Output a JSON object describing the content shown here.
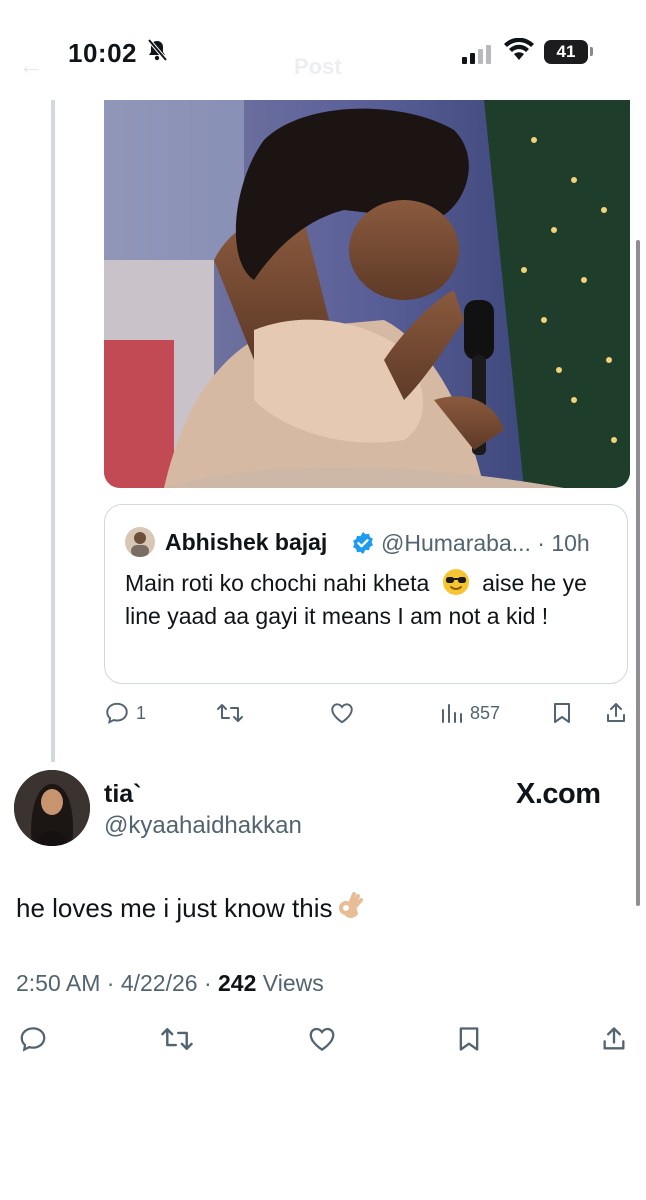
{
  "status_bar": {
    "time": "10:02",
    "battery": "41"
  },
  "header": {
    "title": "Post"
  },
  "quoted": {
    "author_name": "Abhishek bajaj",
    "handle_time": "@Humaraba... · 10h",
    "text_1": "Main roti ko chochi nahi kheta",
    "text_2": "aise he ye line yaad aa gayi it means I am not a kid !"
  },
  "quoted_actions": {
    "replies": "1",
    "views": "857"
  },
  "tweet": {
    "author_name": "tia`",
    "handle": "@kyaahaidhakkan",
    "watermark": "X.com",
    "text": "he loves me i just know this",
    "time_date": "2:50 AM · 4/22/26 · ",
    "views_count": "242",
    "views_label": " Views"
  },
  "colors": {
    "text": "#0f1419",
    "secondary": "#536471",
    "border": "#cfd9de",
    "verified": "#1d9bf0"
  }
}
